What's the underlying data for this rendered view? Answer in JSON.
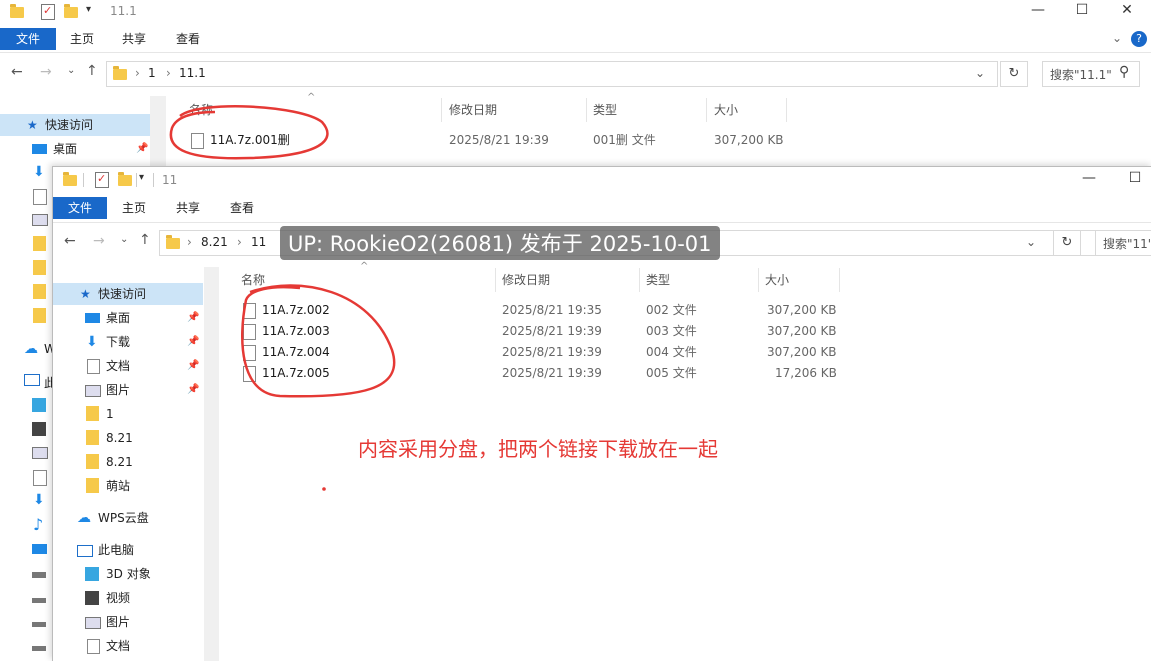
{
  "back_window": {
    "title": "11.1",
    "tabs": [
      "文件",
      "主页",
      "共享",
      "查看"
    ],
    "breadcrumb": [
      "1",
      "11.1"
    ],
    "search_placeholder": "搜索\"11.1\"",
    "columns": [
      "名称",
      "修改日期",
      "类型",
      "大小"
    ],
    "quick_access": "快速访问",
    "desktop": "桌面",
    "file": {
      "name": "11A.7z.001删",
      "date": "2025/8/21 19:39",
      "type": "001删 文件",
      "size": "307,200 KB"
    },
    "side_partial": [
      "W",
      "此"
    ]
  },
  "front_window": {
    "title": "11",
    "tabs": [
      "文件",
      "主页",
      "共享",
      "查看"
    ],
    "breadcrumb": [
      "8.21",
      "11"
    ],
    "search_placeholder": "搜索\"11\"",
    "columns": [
      "名称",
      "修改日期",
      "类型",
      "大小"
    ],
    "sidebar": {
      "quick_access": "快速访问",
      "pinned": [
        "桌面",
        "下载",
        "文档",
        "图片"
      ],
      "folders": [
        "1",
        "8.21",
        "8.21",
        "萌站"
      ],
      "wps": "WPS云盘",
      "this_pc": "此电脑",
      "pc_items": [
        "3D 对象",
        "视频",
        "图片",
        "文档"
      ]
    },
    "files": [
      {
        "name": "11A.7z.002",
        "date": "2025/8/21 19:35",
        "type": "002 文件",
        "size": "307,200 KB"
      },
      {
        "name": "11A.7z.003",
        "date": "2025/8/21 19:39",
        "type": "003 文件",
        "size": "307,200 KB"
      },
      {
        "name": "11A.7z.004",
        "date": "2025/8/21 19:39",
        "type": "004 文件",
        "size": "307,200 KB"
      },
      {
        "name": "11A.7z.005",
        "date": "2025/8/21 19:39",
        "type": "005 文件",
        "size": "17,206 KB"
      }
    ]
  },
  "watermark": "UP: RookieO2(26081) 发布于 2025-10-01",
  "annotation": "内容采用分盘，把两个链接下载放在一起",
  "colors": {
    "accent": "#1968c9",
    "selection": "#cce4f7",
    "annotation": "#e53935"
  }
}
